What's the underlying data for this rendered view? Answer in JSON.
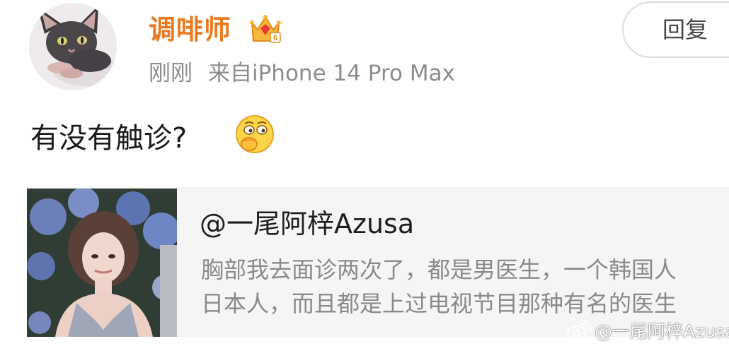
{
  "comment": {
    "author": {
      "name": "调啡师",
      "avatar_icon": "sphynx-cat-avatar",
      "badge_icon": "crown-vip-level-6-icon",
      "badge_level": "6"
    },
    "time": "刚刚",
    "source": "来自iPhone 14 Pro Max",
    "reply_label": "回复",
    "text": "有没有触诊?",
    "emoji": "thinking-face-emoji"
  },
  "quoted_post": {
    "author": "@一尾阿梓Azusa",
    "text_line1": "胸部我去面诊两次了，都是男医生，一个韩国人",
    "text_line2": "日本人，而且都是上过电视节目那种有名的医生"
  },
  "watermark": {
    "text": "@一尾阿梓Azusa",
    "icon": "weibo-logo-icon"
  },
  "colors": {
    "username": "#ea7a1f",
    "meta": "#8c8c8c",
    "quote_background": "#f5f5f5"
  }
}
